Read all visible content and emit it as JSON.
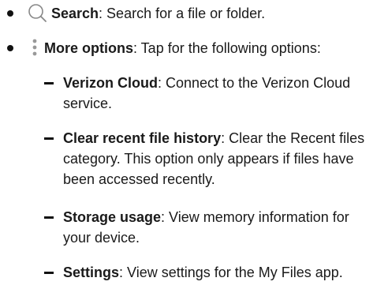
{
  "icons": {
    "search": "search-icon",
    "more": "more-options-icon"
  },
  "items": [
    {
      "term": "Search",
      "desc": ": Search for a file or folder."
    },
    {
      "term": "More options",
      "desc": ": Tap for the following options:"
    }
  ],
  "sub_items": [
    {
      "term": "Verizon Cloud",
      "desc": ": Connect to the Verizon Cloud service."
    },
    {
      "term": "Clear recent file history",
      "desc": ": Clear the Recent files category. This option only appears if files have been accessed recently."
    },
    {
      "term": "Storage usage",
      "desc": ": View memory information for your device."
    },
    {
      "term": "Settings",
      "desc": ": View settings for the My Files app."
    }
  ]
}
